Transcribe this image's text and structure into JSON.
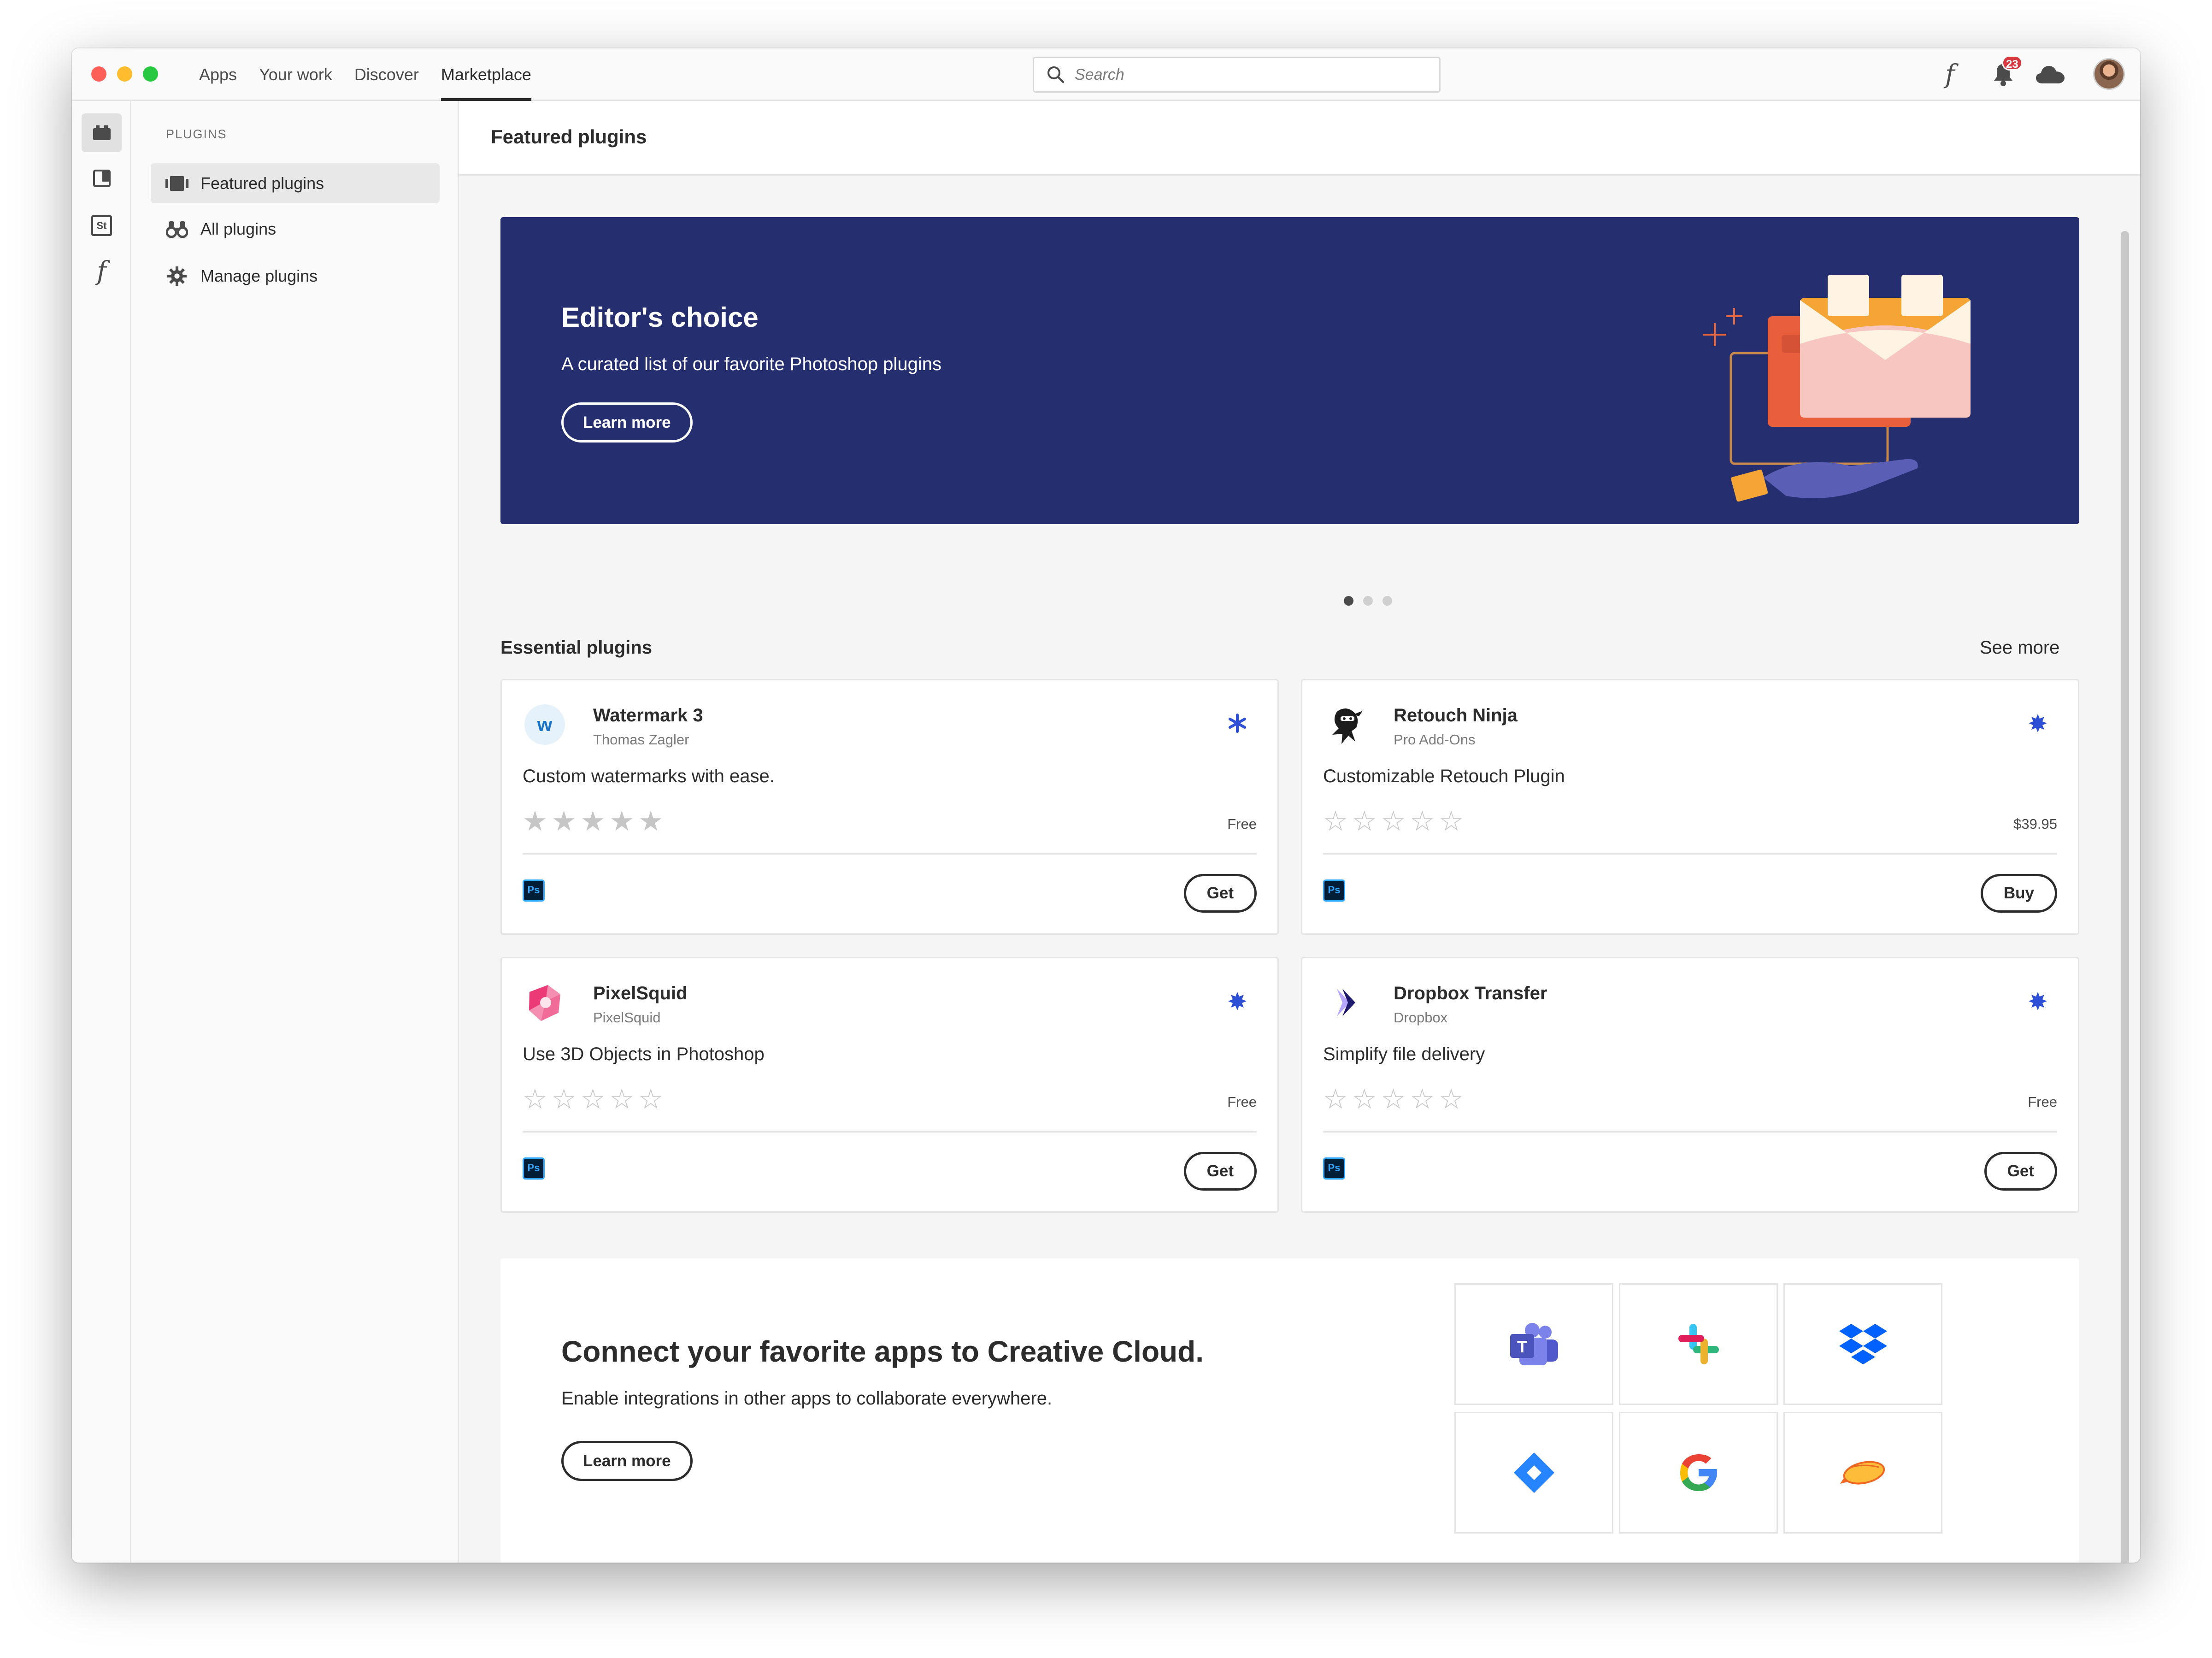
{
  "titlebar": {
    "tabs": [
      {
        "label": "Apps"
      },
      {
        "label": "Your work"
      },
      {
        "label": "Discover"
      },
      {
        "label": "Marketplace",
        "active": true
      }
    ],
    "search_placeholder": "Search",
    "notification_count": "23",
    "icons": [
      "font-icon",
      "bell-icon",
      "cloud-icon",
      "avatar"
    ]
  },
  "rail": {
    "items": [
      "plugins-icon",
      "libraries-icon",
      "stock-icon",
      "fonts-icon"
    ],
    "stock_label": "St",
    "fonts_label": "f"
  },
  "sidebar": {
    "heading": "PLUGINS",
    "items": [
      {
        "label": "Featured plugins",
        "icon": "featured-icon",
        "active": true
      },
      {
        "label": "All plugins",
        "icon": "binoculars-icon"
      },
      {
        "label": "Manage plugins",
        "icon": "gear-icon"
      }
    ]
  },
  "main": {
    "title": "Featured plugins",
    "hero": {
      "title": "Editor's choice",
      "subtitle": "A curated list of our favorite Photoshop plugins",
      "button": "Learn more",
      "slides": 3,
      "active_slide": 1
    },
    "essential": {
      "title": "Essential plugins",
      "see_more": "See more",
      "cards": [
        {
          "name": "Watermark 3",
          "author": "Thomas Zagler",
          "description": "Custom watermarks with ease.",
          "price": "Free",
          "action": "Get",
          "app": "Ps",
          "rating_style": "filled"
        },
        {
          "name": "Retouch Ninja",
          "author": "Pro Add-Ons",
          "description": "Customizable Retouch Plugin",
          "price": "$39.95",
          "action": "Buy",
          "app": "Ps",
          "rating_style": "empty"
        },
        {
          "name": "PixelSquid",
          "author": "PixelSquid",
          "description": "Use 3D Objects in Photoshop",
          "price": "Free",
          "action": "Get",
          "app": "Ps",
          "rating_style": "empty"
        },
        {
          "name": "Dropbox Transfer",
          "author": "Dropbox",
          "description": "Simplify file delivery",
          "price": "Free",
          "action": "Get",
          "app": "Ps",
          "rating_style": "empty"
        }
      ]
    },
    "connect": {
      "title": "Connect your favorite apps to Creative Cloud.",
      "subtitle": "Enable integrations in other apps to collaborate everywhere.",
      "button": "Learn more",
      "apps": [
        "teams-icon",
        "slack-icon",
        "dropbox-icon",
        "jira-icon",
        "google-icon",
        "zeplin-icon"
      ]
    }
  },
  "colors": {
    "hero_bg": "#252f6f",
    "accent_blue": "#2d4fd6",
    "ps_blue": "#31a8ff",
    "badge_red": "#d7373f"
  }
}
